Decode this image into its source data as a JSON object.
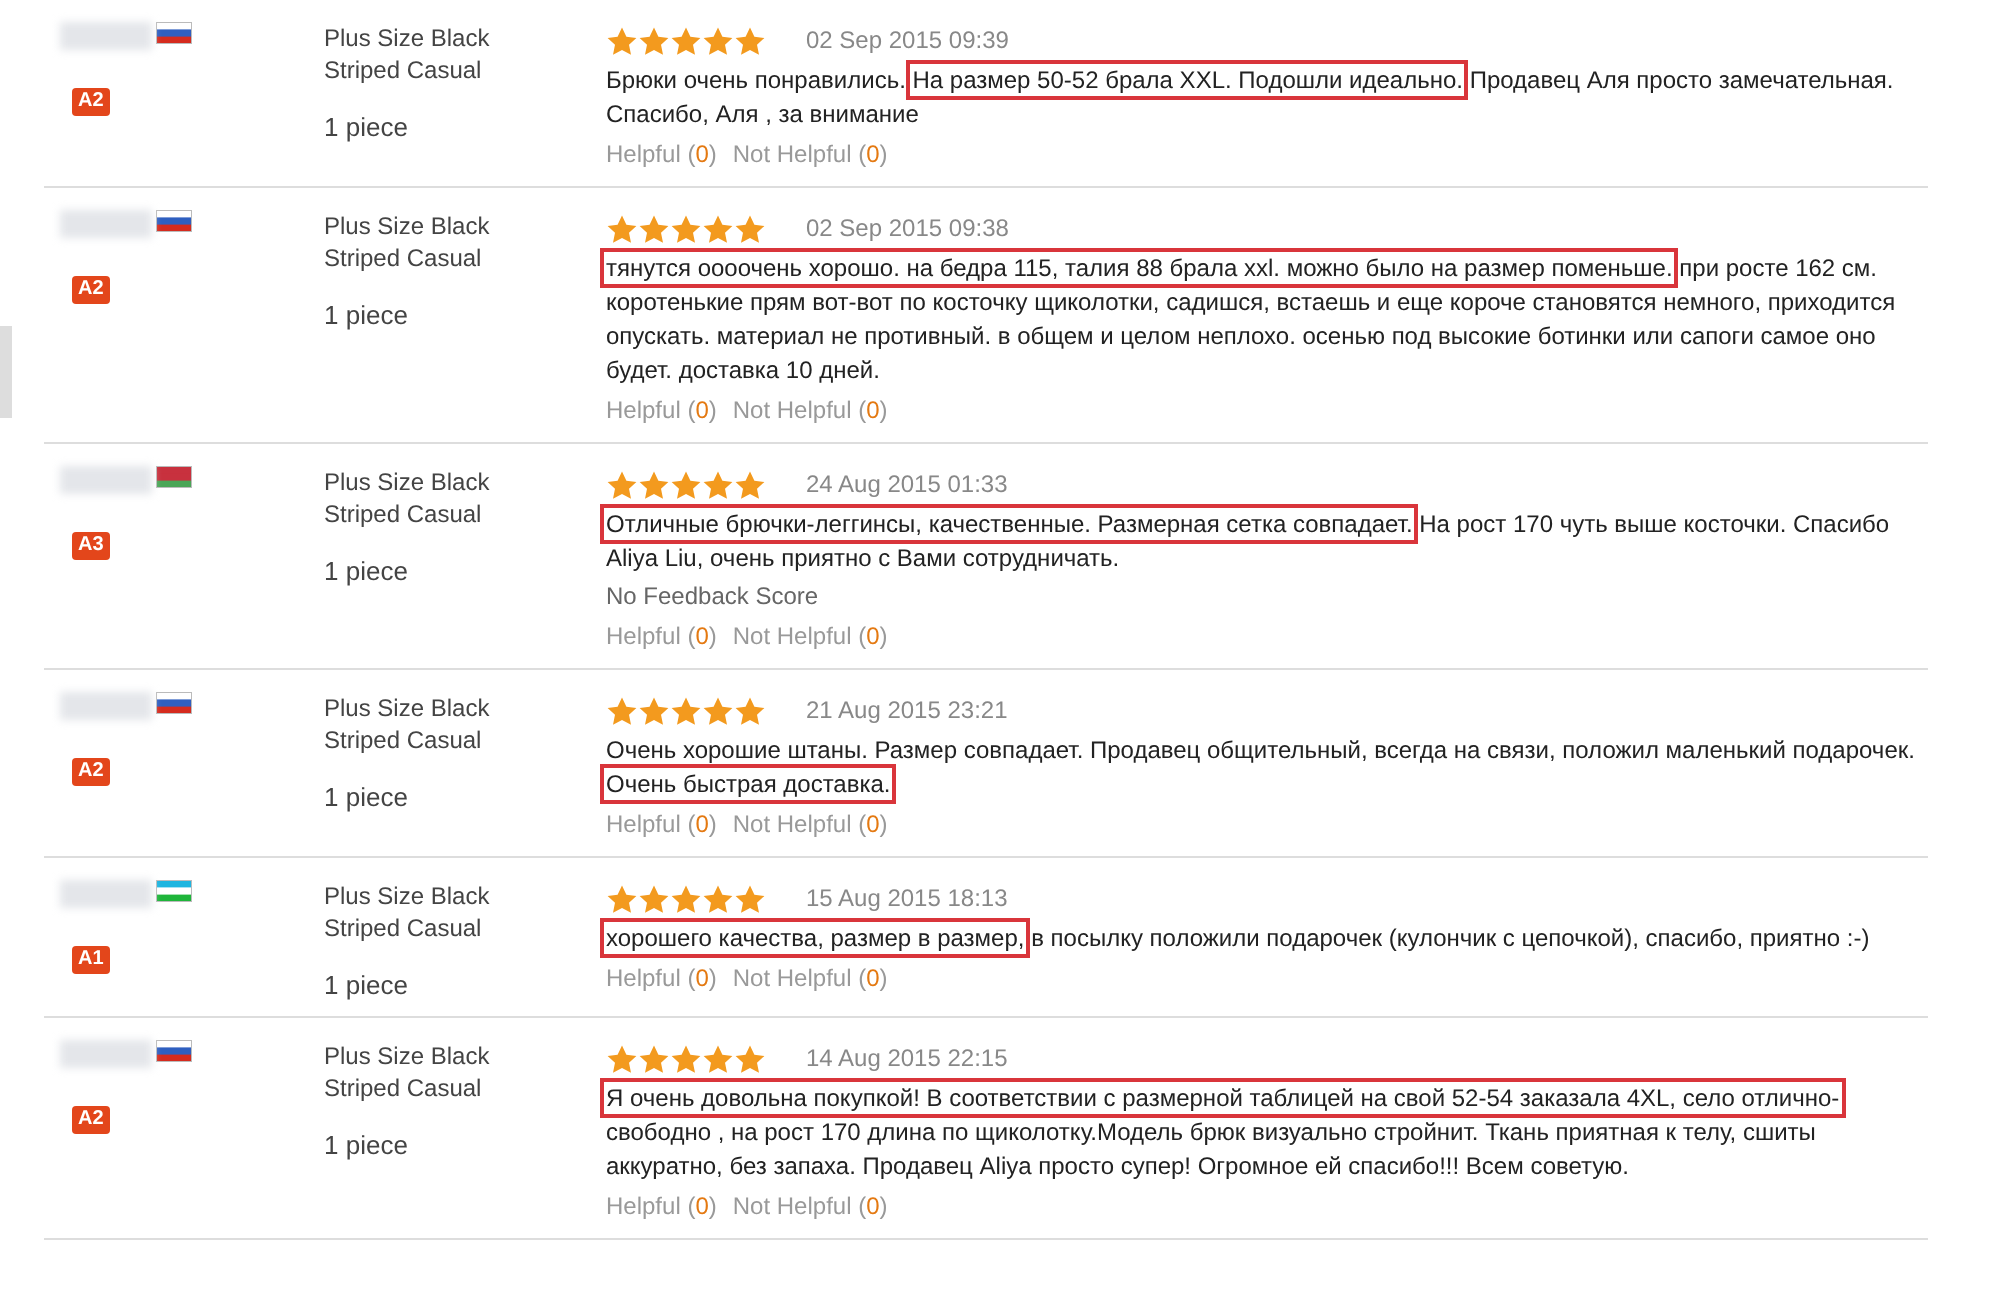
{
  "reviews": [
    {
      "level_badge": "A2",
      "product": "Plus Size Black Striped Casual",
      "quantity": "1 piece",
      "stars": 5,
      "date": "02 Sep 2015 09:39",
      "text": [
        {
          "text": "Брюки очень понравились. ",
          "highlighted": false
        },
        {
          "text": "На размер 50-52 брала XXL. Подошли идеально.",
          "highlighted": true
        },
        {
          "text": " Продавец Аля просто замечательная. Спасибо, Аля , за внимание",
          "highlighted": false
        }
      ],
      "helpful": "Helpful (",
      "helpful_count": "0",
      "helpful_close": ")",
      "not_helpful": "Not Helpful (",
      "not_helpful_count": "0",
      "not_helpful_close": ")"
    },
    {
      "level_badge": "A2",
      "product": "Plus Size Black Striped Casual",
      "quantity": "1 piece",
      "stars": 5,
      "date": "02 Sep 2015 09:38",
      "text": [
        {
          "text": "тянутся оооочень хорошо. на бедра 115, талия 88 брала xxl. можно было на размер поменьше.",
          "highlighted": true
        },
        {
          "text": " при росте 162 см. коротенькие прям вот-вот по косточку щиколотки, садишся, встаешь и еще короче становятся немного, приходится опускать. материал не противный. в общем и целом неплохо. осенью под высокие ботинки или сапоги самое оно будет. доставка 10 дней.",
          "highlighted": false
        }
      ],
      "helpful": "Helpful (",
      "helpful_count": "0",
      "helpful_close": ")",
      "not_helpful": "Not Helpful (",
      "not_helpful_count": "0",
      "not_helpful_close": ")"
    },
    {
      "level_badge": "A3",
      "product": "Plus Size Black Striped Casual",
      "quantity": "1 piece",
      "stars": 5,
      "date": "24 Aug 2015 01:33",
      "text": [
        {
          "text": "Отличные брючки-леггинсы, качественные. Размерная сетка совпадает.",
          "highlighted": true
        },
        {
          "text": " На рост 170 чуть выше косточки. Спасибо Aliya Liu, очень приятно с Вами сотрудничать.",
          "highlighted": false
        }
      ],
      "feedback_score": "No Feedback Score",
      "helpful": "Helpful (",
      "helpful_count": "0",
      "helpful_close": ")",
      "not_helpful": "Not Helpful (",
      "not_helpful_count": "0",
      "not_helpful_close": ")"
    },
    {
      "level_badge": "A2",
      "product": "Plus Size Black Striped Casual",
      "quantity": "1 piece",
      "stars": 5,
      "date": "21 Aug 2015 23:21",
      "text": [
        {
          "text": "Очень хорошие штаны. Размер совпадает. Продавец общительный, всегда на связи, положил маленький подарочек. ",
          "highlighted": false
        },
        {
          "text": "Очень быстрая доставка.",
          "highlighted": true
        }
      ],
      "helpful": "Helpful (",
      "helpful_count": "0",
      "helpful_close": ")",
      "not_helpful": "Not Helpful (",
      "not_helpful_count": "0",
      "not_helpful_close": ")"
    },
    {
      "level_badge": "A1",
      "product": "Plus Size Black Striped Casual",
      "quantity": "1 piece",
      "stars": 5,
      "date": "15 Aug 2015 18:13",
      "text": [
        {
          "text": "хорошего качества, размер в размер,",
          "highlighted": true
        },
        {
          "text": " в посылку положили подарочек (кулончик с цепочкой), спасибо, приятно :-)",
          "highlighted": false
        }
      ],
      "helpful": "Helpful (",
      "helpful_count": "0",
      "helpful_close": ")",
      "not_helpful": "Not Helpful (",
      "not_helpful_count": "0",
      "not_helpful_close": ")"
    },
    {
      "level_badge": "A2",
      "product": "Plus Size Black Striped Casual",
      "quantity": "1 piece",
      "stars": 5,
      "date": "14 Aug 2015 22:15",
      "text": [
        {
          "text": "Я очень довольна покупкой! В соответствии с размерной таблицей на свой 52-54 заказала 4XL, село отлично-",
          "highlighted": true
        },
        {
          "text": " свободно , на рост 170 длина по щиколотку.Модель брюк визуально стройнит. Ткань приятная к телу, сшиты аккуратно, без запаха. Продавец Aliya просто супер! Огромное ей спасибо!!! Всем советую.",
          "highlighted": false
        }
      ],
      "helpful": "Helpful (",
      "helpful_count": "0",
      "helpful_close": ")",
      "not_helpful": "Not Helpful (",
      "not_helpful_count": "0",
      "not_helpful_close": ")"
    }
  ]
}
